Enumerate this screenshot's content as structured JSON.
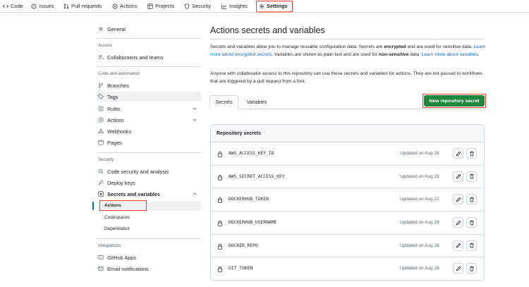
{
  "top_nav": {
    "tabs": [
      "Code",
      "Issues",
      "Pull requests",
      "Actions",
      "Projects",
      "Security",
      "Insights",
      "Settings"
    ],
    "active": "Settings"
  },
  "sidebar": {
    "general": "General",
    "sections": [
      {
        "heading": "Access",
        "items": [
          "Collaborators and teams"
        ]
      },
      {
        "heading": "Code and automation",
        "items": [
          "Branches",
          "Tags",
          "Rules",
          "Actions",
          "Webhooks",
          "Pages"
        ]
      },
      {
        "heading": "Security",
        "items": [
          "Code security and analysis",
          "Deploy keys",
          "Secrets and variables"
        ],
        "subitems": [
          "Actions",
          "Codespaces",
          "Dependabot"
        ]
      },
      {
        "heading": "Integrations",
        "items": [
          "GitHub Apps",
          "Email notifications"
        ]
      }
    ]
  },
  "main": {
    "title": "Actions secrets and variables",
    "desc1_a": "Secrets and variables allow you to manage reusable configuration data. Secrets are ",
    "desc1_b": "encrypted",
    "desc1_c": " and are used for sensitive data. ",
    "desc1_link1": "Learn more about encrypted secrets",
    "desc1_d": ". Variables are shown as plain text and are used for ",
    "desc1_e": "non-sensitive",
    "desc1_f": " data. ",
    "desc1_link2": "Learn more about variables",
    "desc1_g": ".",
    "desc2": "Anyone with collaborator access to this repository can use these secrets and variables for actions. They are not passed to workflows that are triggered by a pull request from a fork.",
    "tabs": [
      "Secrets",
      "Variables"
    ],
    "new_button": "New repository secret",
    "panel_title": "Repository secrets",
    "secrets": [
      {
        "name": "AWS_ACCESS_KEY_ID",
        "updated": "Updated on Aug 28"
      },
      {
        "name": "AWS_SECRET_ACCESS_KEY",
        "updated": "Updated on Aug 28"
      },
      {
        "name": "DOCKERHUB_TOKEN",
        "updated": "Updated on Aug 22"
      },
      {
        "name": "DOCKERHUB_USERNAME",
        "updated": "Updated on Aug 28"
      },
      {
        "name": "DOCKER_REPO",
        "updated": "Updated on Aug 28"
      },
      {
        "name": "GIT_TOKEN",
        "updated": "Updated on Aug 28"
      }
    ]
  },
  "colors": {
    "accent": "#0969da",
    "primary_button": "#1f883d",
    "highlight": "#e5432f"
  }
}
